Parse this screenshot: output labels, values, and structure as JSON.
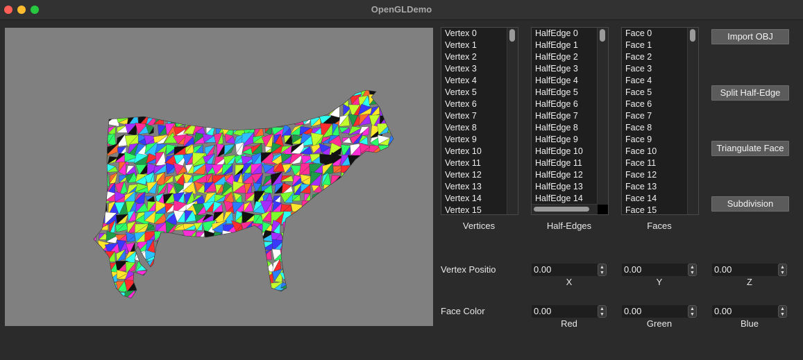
{
  "window": {
    "title": "OpenGLDemo"
  },
  "lists": {
    "vertices": {
      "items": [
        "Vertex 0",
        "Vertex 1",
        "Vertex 2",
        "Vertex 3",
        "Vertex 4",
        "Vertex 5",
        "Vertex 6",
        "Vertex 7",
        "Vertex 8",
        "Vertex 9",
        "Vertex 10",
        "Vertex 11",
        "Vertex 12",
        "Vertex 13",
        "Vertex 14",
        "Vertex 15"
      ],
      "caption": "Vertices"
    },
    "halfedges": {
      "items": [
        "HalfEdge 0",
        "HalfEdge 1",
        "HalfEdge 2",
        "HalfEdge 3",
        "HalfEdge 4",
        "HalfEdge 5",
        "HalfEdge 6",
        "HalfEdge 7",
        "HalfEdge 8",
        "HalfEdge 9",
        "HalfEdge 10",
        "HalfEdge 11",
        "HalfEdge 12",
        "HalfEdge 13",
        "HalfEdge 14"
      ],
      "caption": "Half-Edges"
    },
    "faces": {
      "items": [
        "Face 0",
        "Face 1",
        "Face 2",
        "Face 3",
        "Face 4",
        "Face 5",
        "Face 6",
        "Face 7",
        "Face 8",
        "Face 9",
        "Face 10",
        "Face 11",
        "Face 12",
        "Face 13",
        "Face 14",
        "Face 15"
      ],
      "caption": "Faces"
    }
  },
  "buttons": {
    "import": "Import OBJ",
    "split": "Split Half-Edge",
    "triangulate": "Triangulate Face",
    "subdivision": "Subdivision"
  },
  "vertex_position": {
    "label": "Vertex Positio",
    "x": {
      "value": "0.00",
      "label": "X"
    },
    "y": {
      "value": "0.00",
      "label": "Y"
    },
    "z": {
      "value": "0.00",
      "label": "Z"
    }
  },
  "face_color": {
    "label": "Face Color",
    "red": {
      "value": "0.00",
      "label": "Red"
    },
    "green": {
      "value": "0.00",
      "label": "Green"
    },
    "blue": {
      "value": "0.00",
      "label": "Blue"
    }
  },
  "viewport": {
    "background": "#808080",
    "model_icon": "cow-mesh-icon"
  }
}
